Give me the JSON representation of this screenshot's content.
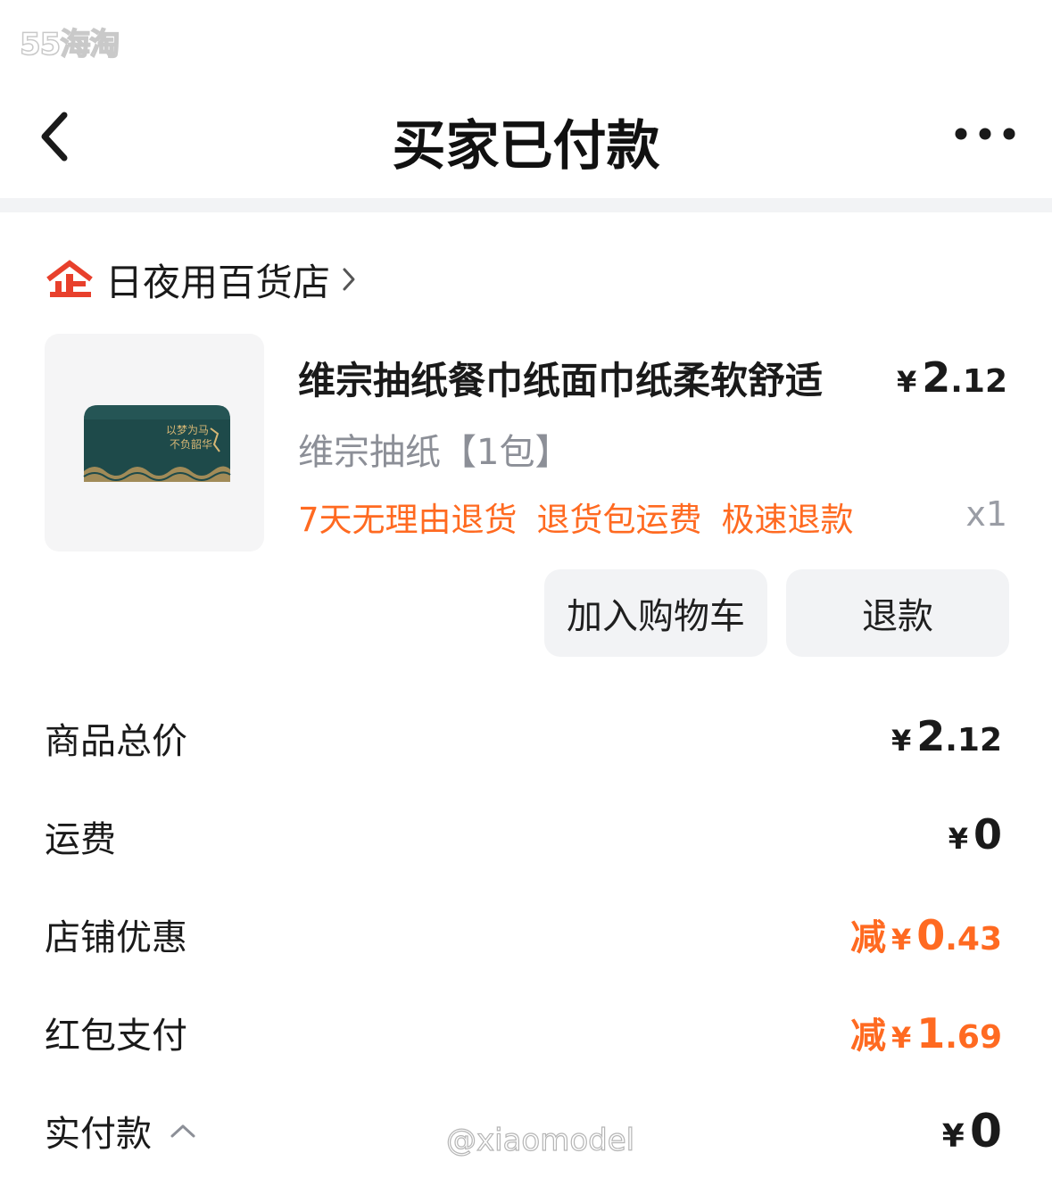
{
  "watermarks": {
    "top": "55海淘",
    "bottom": "@xiaomodel"
  },
  "nav": {
    "title": "买家已付款"
  },
  "store": {
    "name": "日夜用百货店"
  },
  "product": {
    "title": "维宗抽纸餐巾纸面巾纸柔软舒适",
    "price_symbol": "¥",
    "price_int": "2",
    "price_dec": ".12",
    "sku": "维宗抽纸【1包】",
    "tags": [
      "7天无理由退货",
      "退货包运费",
      "极速退款"
    ],
    "quantity": "x1",
    "image_text": [
      "以梦为马",
      "不负韶华"
    ]
  },
  "actions": {
    "add_to_cart": "加入购物车",
    "refund": "退款"
  },
  "summary": {
    "goods_total": {
      "label": "商品总价",
      "symbol": "¥",
      "int": "2",
      "dec": ".12"
    },
    "shipping": {
      "label": "运费",
      "symbol": "¥",
      "int": "0"
    },
    "store_discount": {
      "label": "店铺优惠",
      "prefix": "减",
      "symbol": "¥",
      "int": "0",
      "dec": ".43"
    },
    "red_packet": {
      "label": "红包支付",
      "prefix": "减",
      "symbol": "¥",
      "int": "1",
      "dec": ".69"
    },
    "paid": {
      "label": "实付款",
      "symbol": "¥",
      "int": "0"
    }
  },
  "colors": {
    "accent": "#ff6a21",
    "store_icon": "#e8402c",
    "muted": "#8c8f97"
  },
  "icons": {
    "back": "chevron-left-icon",
    "more": "more-dots-icon",
    "store": "enterprise-store-icon",
    "store_arrow": "chevron-right-icon",
    "expand": "chevron-up-icon"
  }
}
